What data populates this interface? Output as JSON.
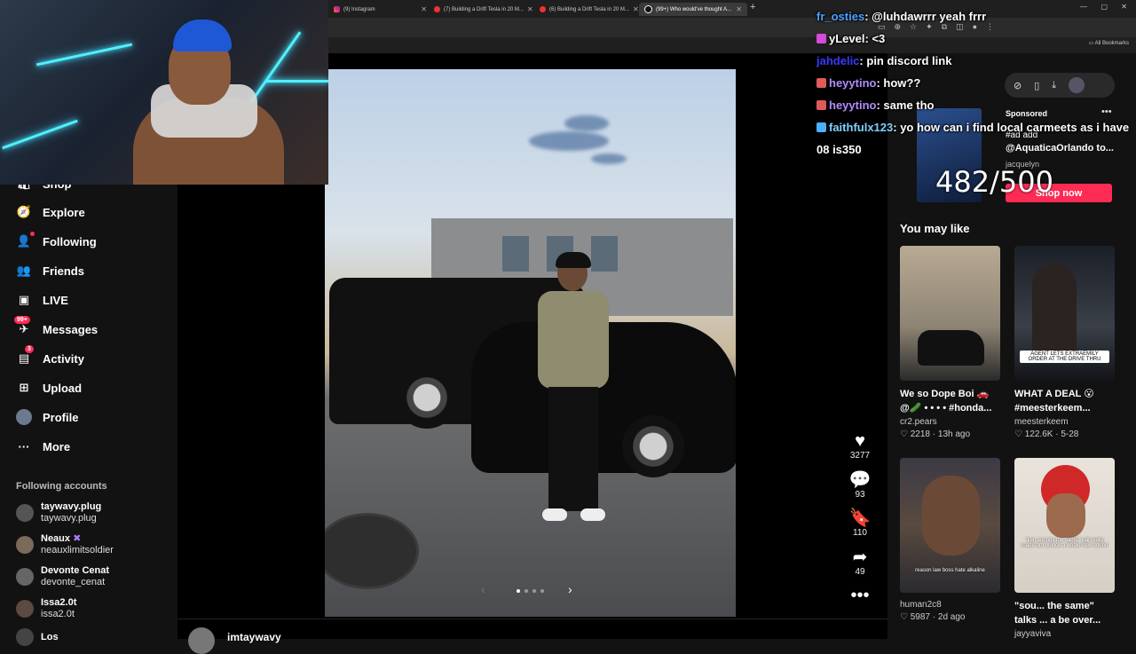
{
  "browser": {
    "tabs": [
      {
        "title": "(9) Instagram",
        "icon": "instagram-icon"
      },
      {
        "title": "(7) Building a Drift Tesla in 20 M...",
        "icon": "youtube-icon"
      },
      {
        "title": "(6) Building a Drift Tesla in 20 M...",
        "icon": "youtube-icon"
      },
      {
        "title": "(99+) Who would've thought A...",
        "icon": "tiktok-icon"
      }
    ],
    "new_tab_label": "+",
    "bookmarks_label": "All Bookmarks"
  },
  "sidebar": {
    "items": [
      {
        "label": "Shop",
        "icon": "shop-icon"
      },
      {
        "label": "Explore",
        "icon": "compass-icon"
      },
      {
        "label": "Following",
        "icon": "following-icon"
      },
      {
        "label": "Friends",
        "icon": "friends-icon"
      },
      {
        "label": "LIVE",
        "icon": "live-icon"
      },
      {
        "label": "Messages",
        "icon": "messages-icon",
        "badge": "99+"
      },
      {
        "label": "Activity",
        "icon": "activity-icon",
        "badge": "3"
      },
      {
        "label": "Upload",
        "icon": "upload-icon"
      },
      {
        "label": "Profile",
        "icon": "profile-avatar"
      },
      {
        "label": "More",
        "icon": "more-icon"
      }
    ],
    "following_title": "Following accounts",
    "accounts": [
      {
        "name": "taywavy.plug",
        "handle": "taywavy.plug"
      },
      {
        "name": "Neaux",
        "handle": "neauxlimitsoldier"
      },
      {
        "name": "Devonte Cenat",
        "handle": "devonte_cenat"
      },
      {
        "name": "Issa2.0t",
        "handle": "issa2.0t"
      },
      {
        "name": "Los",
        "handle": ""
      }
    ]
  },
  "post": {
    "author": "imtaywavy",
    "carousel": {
      "count": 4,
      "active": 0
    },
    "actions": [
      {
        "icon": "heart-icon",
        "count": "3277"
      },
      {
        "icon": "comment-icon",
        "count": "93"
      },
      {
        "icon": "bookmark-icon",
        "count": "110"
      },
      {
        "icon": "share-icon",
        "count": "49"
      },
      {
        "icon": "more-dots-icon",
        "count": ""
      }
    ]
  },
  "ad": {
    "sponsored": "Sponsored",
    "title": "#ad add",
    "handle": "@AquaticaOrlando to...",
    "user": "jacquelyn",
    "button": "Shop now"
  },
  "goal_overlay": "482/500",
  "you_may_like": {
    "title": "You may like",
    "cards": [
      {
        "caption": "We so Dope Boi 🚗",
        "caption2": "@🥒 • • • • #honda...",
        "user": "cr2.pears",
        "likes": "2218",
        "age": "13h ago",
        "thumb_text": ""
      },
      {
        "caption": "WHAT A DEAL 😮",
        "caption2": "#meesterkeem...",
        "user": "meesterkeem",
        "likes": "122.6K",
        "age": "5-28",
        "thumb_text": "AGENT LETS EXTRAEMILY ORDER AT THE DRIVE THRU"
      },
      {
        "caption": "",
        "caption2": "",
        "user": "human2c8",
        "likes": "5987",
        "age": "2d ago",
        "thumb_text": "reason law boss hate alkaline"
      },
      {
        "caption": "\"sou... the same\"",
        "caption2": "talks ... a be over...",
        "user": "jayyaviva",
        "likes": "",
        "age": "",
        "thumb_text": "\"ken sounds the same\" yall really made bro unlock a whole new sound"
      }
    ]
  },
  "chat": [
    {
      "user": "fr_osties",
      "color": "#4aa3ff",
      "msg": "@luhdawrrr yeah frrr",
      "icon": ""
    },
    {
      "user": "yLevel",
      "color": "#ffffff",
      "msg": "<3",
      "icon": "badge-icon"
    },
    {
      "user": "jahdelic",
      "color": "#3a3aff",
      "msg": "pin discord link",
      "icon": ""
    },
    {
      "user": "heyytino",
      "color": "#b28cff",
      "msg": "how??",
      "icon": "gift-icon"
    },
    {
      "user": "heyytino",
      "color": "#b28cff",
      "msg": "same tho",
      "icon": "gift-icon"
    },
    {
      "user": "faithfulx123",
      "color": "#7fd0ff",
      "msg": "yo how can i find local carmeets as i have 08 is350",
      "icon": "crown-icon"
    }
  ]
}
